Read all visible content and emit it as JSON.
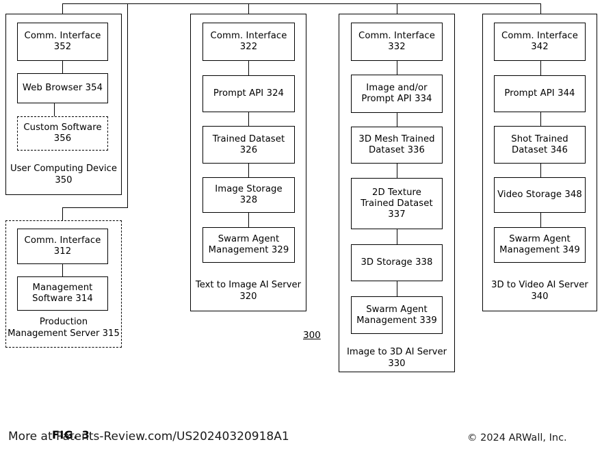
{
  "figure": {
    "number_label": "300",
    "fig_label": "FIG. 3",
    "watermark": "More at Patents-Review.com/US20240320918A1",
    "copyright": "© 2024 ARWall, Inc."
  },
  "columns": {
    "user_device": {
      "title": "User Computing Device\n350",
      "nodes": [
        {
          "id": "352",
          "label": "Comm. Interface\n352",
          "style": "solid"
        },
        {
          "id": "354",
          "label": "Web Browser 354",
          "style": "solid"
        },
        {
          "id": "356",
          "label": "Custom Software\n356",
          "style": "dashed"
        }
      ]
    },
    "production_mgmt": {
      "title": "Production\nManagement Server 315",
      "frame_style": "dashed",
      "nodes": [
        {
          "id": "312",
          "label": "Comm. Interface\n312",
          "style": "solid"
        },
        {
          "id": "314",
          "label": "Management\nSoftware 314",
          "style": "solid"
        }
      ]
    },
    "text_to_image": {
      "title": "Text to Image AI Server\n320",
      "nodes": [
        {
          "id": "322",
          "label": "Comm. Interface\n322",
          "style": "solid"
        },
        {
          "id": "324",
          "label": "Prompt API 324",
          "style": "solid"
        },
        {
          "id": "326",
          "label": "Trained Dataset\n326",
          "style": "solid"
        },
        {
          "id": "328",
          "label": "Image Storage 328",
          "style": "solid"
        },
        {
          "id": "329",
          "label": "Swarm Agent\nManagement 329",
          "style": "solid"
        }
      ]
    },
    "image_to_3d": {
      "title": "Image to 3D AI Server\n330",
      "nodes": [
        {
          "id": "332",
          "label": "Comm. Interface\n332",
          "style": "solid"
        },
        {
          "id": "334",
          "label": "Image and/or\nPrompt API 334",
          "style": "solid"
        },
        {
          "id": "336",
          "label": "3D Mesh Trained\nDataset 336",
          "style": "solid"
        },
        {
          "id": "337",
          "label": "2D Texture\nTrained Dataset\n337",
          "style": "solid"
        },
        {
          "id": "338",
          "label": "3D Storage 338",
          "style": "solid"
        },
        {
          "id": "339",
          "label": "Swarm Agent\nManagement 339",
          "style": "solid"
        }
      ]
    },
    "three_d_to_video": {
      "title": "3D to Video AI Server\n340",
      "nodes": [
        {
          "id": "342",
          "label": "Comm. Interface\n342",
          "style": "solid"
        },
        {
          "id": "344",
          "label": "Prompt API 344",
          "style": "solid"
        },
        {
          "id": "346",
          "label": "Shot Trained\nDataset 346",
          "style": "solid"
        },
        {
          "id": "348",
          "label": "Video Storage 348",
          "style": "solid"
        },
        {
          "id": "349",
          "label": "Swarm Agent\nManagement 349",
          "style": "solid"
        }
      ]
    }
  },
  "colors": {
    "stroke": "#000000",
    "background": "#ffffff"
  }
}
